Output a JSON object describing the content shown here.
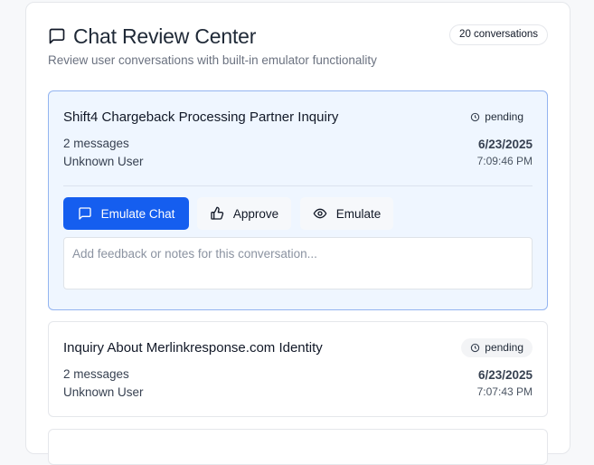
{
  "header": {
    "title": "Chat Review Center",
    "subtitle": "Review user conversations with built-in emulator functionality",
    "count_badge": "20 conversations"
  },
  "conversations": [
    {
      "title": "Shift4 Chargeback Processing Partner Inquiry",
      "status": "pending",
      "messages": "2 messages",
      "user": "Unknown User",
      "date": "6/23/2025",
      "time": "7:09:46 PM",
      "actions": {
        "emulate_chat": "Emulate Chat",
        "approve": "Approve",
        "emulate": "Emulate"
      },
      "feedback_placeholder": "Add feedback or notes for this conversation..."
    },
    {
      "title": "Inquiry About Merlinkresponse.com Identity",
      "status": "pending",
      "messages": "2 messages",
      "user": "Unknown User",
      "date": "6/23/2025",
      "time": "7:07:43 PM"
    }
  ],
  "colors": {
    "primary": "#155eef",
    "active_card_bg": "#eff6ff",
    "active_card_border": "#93b4f0"
  },
  "icons": {
    "title": "message-square-icon",
    "status": "clock-icon",
    "emulate_chat": "message-square-icon",
    "approve": "thumbs-up-icon",
    "emulate": "eye-icon"
  }
}
